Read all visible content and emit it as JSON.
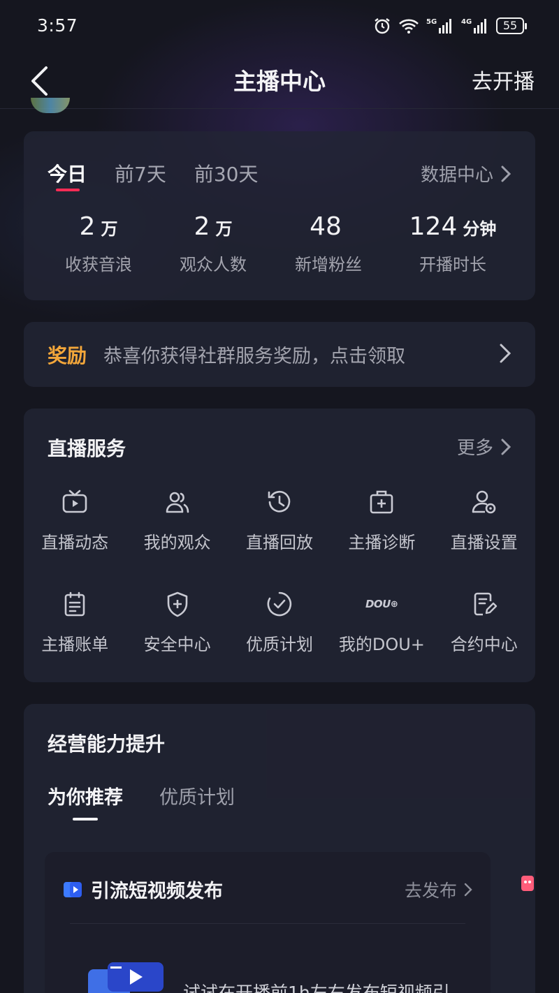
{
  "status_bar": {
    "time": "3:57",
    "battery": "55",
    "icons": [
      "alarm-icon",
      "wifi-icon",
      "signal-5g-icon",
      "signal-4g-icon",
      "battery-icon"
    ]
  },
  "header": {
    "title": "主播中心",
    "action": "去开播"
  },
  "stats": {
    "tabs": [
      "今日",
      "前7天",
      "前30天"
    ],
    "active_tab": "今日",
    "data_center": "数据中心",
    "items": [
      {
        "value": "2",
        "unit": "万",
        "label": "收获音浪"
      },
      {
        "value": "2",
        "unit": "万",
        "label": "观众人数"
      },
      {
        "value": "48",
        "unit": "",
        "label": "新增粉丝"
      },
      {
        "value": "124",
        "unit": "分钟",
        "label": "开播时长"
      }
    ]
  },
  "reward": {
    "tag": "奖励",
    "text": "恭喜你获得社群服务奖励，点击领取"
  },
  "services": {
    "title": "直播服务",
    "more": "更多",
    "items": [
      {
        "label": "直播动态",
        "icon": "tv-icon"
      },
      {
        "label": "我的观众",
        "icon": "audience-icon"
      },
      {
        "label": "直播回放",
        "icon": "replay-icon"
      },
      {
        "label": "主播诊断",
        "icon": "medical-kit-icon"
      },
      {
        "label": "直播设置",
        "icon": "user-settings-icon"
      },
      {
        "label": "主播账单",
        "icon": "clipboard-icon"
      },
      {
        "label": "安全中心",
        "icon": "shield-plus-icon"
      },
      {
        "label": "优质计划",
        "icon": "check-circle-icon"
      },
      {
        "label": "我的DOU+",
        "icon": "dou-plus-icon"
      },
      {
        "label": "合约中心",
        "icon": "contract-edit-icon"
      }
    ],
    "dou_logo_text": "DOU"
  },
  "business": {
    "title": "经营能力提升",
    "tabs": [
      "为你推荐",
      "优质计划"
    ],
    "active_tab": "为你推荐",
    "card": {
      "title": "引流短视频发布",
      "action": "去发布",
      "body": "试试在开播前1h左右发布短视频引"
    }
  },
  "colors": {
    "background": "#15161f",
    "card": "#222434",
    "accent_red": "#ff2c55",
    "reward_orange": "#f2a63a"
  }
}
